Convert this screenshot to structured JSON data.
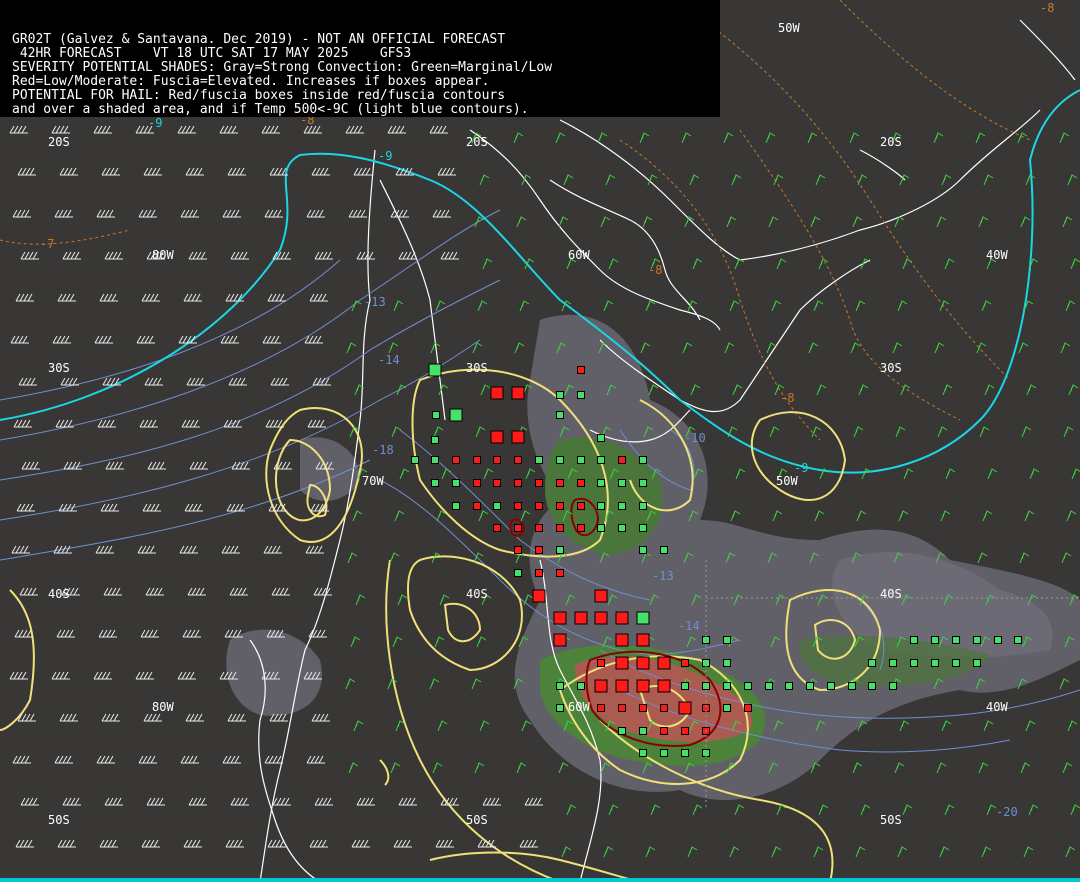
{
  "header": {
    "lines": [
      "GR02T (Galvez & Santavana. Dec 2019) - NOT AN OFFICIAL FORECAST",
      " 42HR FORECAST    VT 18 UTC SAT 17 MAY 2025    GFS3",
      "SEVERITY POTENTIAL SHADES: Gray=Strong Convection: Green=Marginal/Low",
      "Red=Low/Moderate: Fuscia=Elevated. Increases if boxes appear.",
      "POTENTIAL FOR HAIL: Red/fuscia boxes inside red/fuscia contours",
      "and over a shaded area, and if Temp 500<-9C (light blue contours)."
    ]
  },
  "grid_labels": {
    "lon_80w_top": "80W",
    "lon_60w_top": "60W",
    "lon_50w_top": "50W",
    "lon_40w_top": "40W",
    "lon_70w": "70W",
    "lon_50w_mid": "50W",
    "lon_80w_bottom": "80W",
    "lon_60w_bottom": "60W",
    "lon_40w_bottom": "40W",
    "lat_20s_left": "20S",
    "lat_20s_mid": "20S",
    "lat_20s_right": "20S",
    "lat_30s_left": "30S",
    "lat_30s_mid": "30S",
    "lat_30s_right": "30S",
    "lat_40s_left": "40S",
    "lat_40s_mid": "40S",
    "lat_40s_right": "40S",
    "lat_50s_left": "50S",
    "lat_50s_mid": "50S",
    "lat_50s_right": "50S"
  },
  "contour_values": {
    "cyan_a": "-9",
    "cyan_b": "-9",
    "cyan_c": "-9",
    "blue_a": "-13",
    "blue_b": "-14",
    "blue_c": "-18",
    "blue_d": "-10",
    "blue_e": "-13",
    "blue_f": "-14",
    "blue_g": "-20",
    "orange_a": "-7",
    "orange_b": "-8",
    "orange_c": "-8",
    "orange_d": "-8",
    "orange_e": "-8"
  },
  "colors": {
    "background": "#383735",
    "temp500_cyan": "#1ad6e6",
    "temp500_blue": "#6f8fd0",
    "orange": "#c8782a",
    "yellow": "#f0e07a",
    "green_box": "#46e06a",
    "red_box": "#ff1a1a",
    "dark_red": "#8a0000",
    "gray_shade": "#6e6d78",
    "green_shade": "#4e8a3a",
    "red_shade": "#b95f55"
  }
}
